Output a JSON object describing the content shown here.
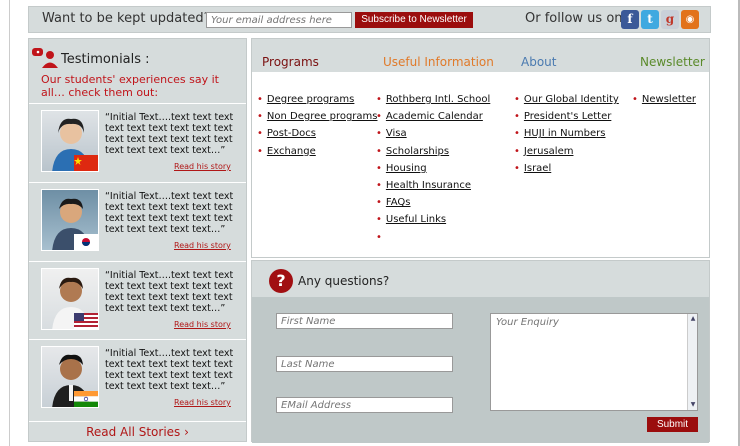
{
  "topbar": {
    "kept_updated": "Want to be kept updated?",
    "email_placeholder": "Your email address here",
    "subscribe_label": "Subscribe to Newsletter",
    "follow_label": "Or follow us on:",
    "social": [
      {
        "icon": "facebook-icon",
        "glyph": "f",
        "color": "#3b5998"
      },
      {
        "icon": "twitter-icon",
        "glyph": "t",
        "color": "#3fa9e0"
      },
      {
        "icon": "google-plus-icon",
        "glyph": "g",
        "color": "#c9d0d8"
      },
      {
        "icon": "rss-icon",
        "glyph": "◉",
        "color": "#e2731b"
      }
    ]
  },
  "testimonials": {
    "title": "Testimonials :",
    "subtitle": "Our students' experiences say it all… check them out:",
    "stories": [
      {
        "quote": "“Initial Text….text text text text text text text text text text text text text text text text text text text text…”",
        "link": "Read his story",
        "flag": "china"
      },
      {
        "quote": "“Initial Text….text text text text text text text text text text text text text text text text text text text text…”",
        "link": "Read his story",
        "flag": "korea"
      },
      {
        "quote": "“Initial Text….text text text text text text text text text text text text text text text text text text text text…”",
        "link": "Read his story",
        "flag": "usa"
      },
      {
        "quote": "“Initial Text….text text text text text text text text text text text text text text text text text text text text…”",
        "link": "Read his story",
        "flag": "india"
      }
    ],
    "read_all": "Read All Stories ›"
  },
  "menu": {
    "headers": [
      "Programs",
      "Useful Information",
      "About",
      "Newsletter"
    ],
    "programs": [
      "Degree programs",
      "Non Degree programs",
      "Post-Docs",
      "Exchange"
    ],
    "useful": [
      "Rothberg Intl. School",
      "Academic Calendar",
      "Visa",
      "Scholarships",
      "Housing",
      "Health Insurance",
      "FAQs",
      "Useful Links",
      ""
    ],
    "about": [
      "Our Global Identity",
      "President's Letter",
      "HUJI in Numbers",
      "Jerusalem",
      "Israel"
    ],
    "newsletter": [
      "Newsletter"
    ]
  },
  "questions": {
    "title": "Any questions?",
    "first_name": "First Name",
    "last_name": "Last Name",
    "email": "EMail Address",
    "enquiry": "Your Enquiry",
    "submit": "Submit"
  },
  "colors": {
    "accent_red": "#9b0d0d",
    "panel_gray": "#d6dcdc",
    "link_red": "#b01717"
  }
}
